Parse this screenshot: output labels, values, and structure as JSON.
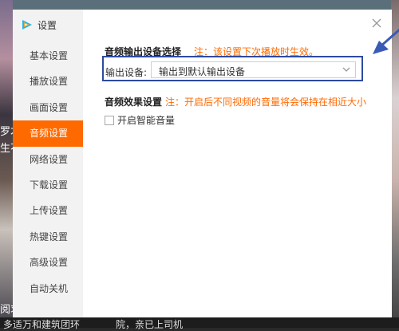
{
  "background": {
    "left_text_1": "罗才",
    "left_text_2": "生不",
    "left_text_3": "阅求",
    "bottom_text_1": "多适万和建筑团环",
    "bottom_text_2": "院，亲已上司机"
  },
  "dialog": {
    "title": "设置",
    "menu": [
      {
        "label": "基本设置",
        "active": false
      },
      {
        "label": "播放设置",
        "active": false
      },
      {
        "label": "画面设置",
        "active": false
      },
      {
        "label": "音频设置",
        "active": true
      },
      {
        "label": "网络设置",
        "active": false
      },
      {
        "label": "下载设置",
        "active": false
      },
      {
        "label": "上传设置",
        "active": false
      },
      {
        "label": "热键设置",
        "active": false
      },
      {
        "label": "高级设置",
        "active": false
      },
      {
        "label": "自动关机",
        "active": false
      }
    ],
    "audio_output": {
      "title": "音频输出设备选择",
      "note": "注：该设置下次播放时生效。",
      "device_label": "输出设备:",
      "device_value": "输出到默认输出设备"
    },
    "audio_effect": {
      "title": "音频效果设置",
      "note": "注：开启后不同视频的音量将会保持在相近大小",
      "smart_volume_label": "开启智能音量",
      "smart_volume_checked": false
    }
  },
  "colors": {
    "accent": "#ff6a00",
    "highlight_box": "#2e4aa0",
    "annotation_arrow": "#3a5bb5"
  },
  "icons": {
    "logo": "tencent-video-logo-icon",
    "close": "close-icon",
    "dropdown": "chevron-down-icon",
    "annotation": "annotation-arrow-icon"
  }
}
